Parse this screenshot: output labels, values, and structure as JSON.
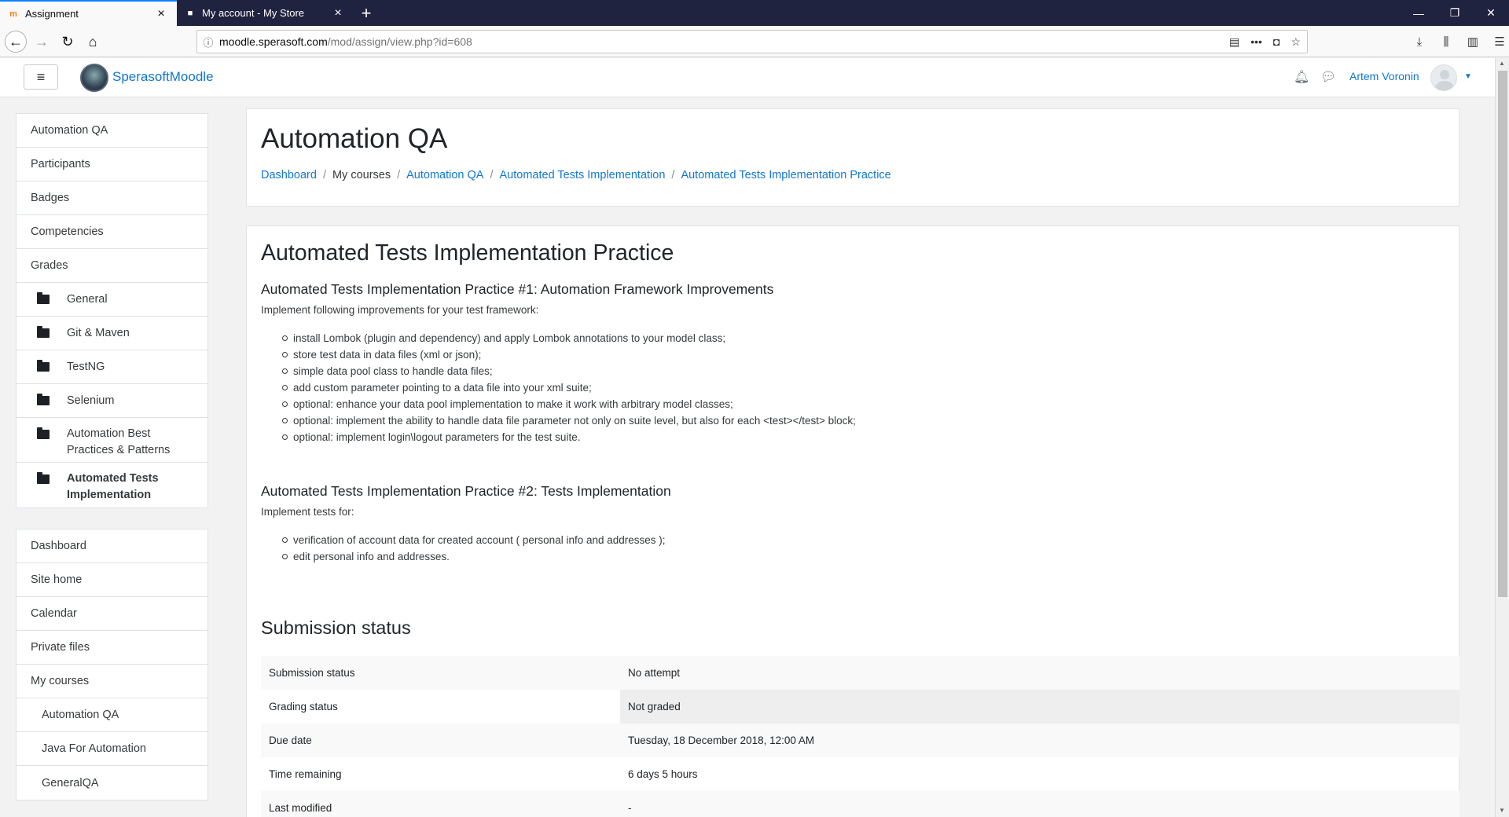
{
  "browser": {
    "tabs": [
      {
        "title": "Assignment",
        "active": true
      },
      {
        "title": "My account - My Store",
        "active": false
      }
    ],
    "url_host": "moodle.sperasoft.com",
    "url_path": "/mod/assign/view.php?id=608"
  },
  "header": {
    "brand": "SperasoftMoodle",
    "user_name": "Artem Voronin"
  },
  "sidebar": {
    "course_nav": [
      {
        "label": "Automation QA"
      },
      {
        "label": "Participants"
      },
      {
        "label": "Badges"
      },
      {
        "label": "Competencies"
      },
      {
        "label": "Grades"
      },
      {
        "label": "General"
      },
      {
        "label": "Git & Maven"
      },
      {
        "label": "TestNG"
      },
      {
        "label": "Selenium"
      },
      {
        "label": "Automation Best Practices & Patterns"
      },
      {
        "label": "Automated Tests Implementation"
      }
    ],
    "site_nav": [
      {
        "label": "Dashboard"
      },
      {
        "label": "Site home"
      },
      {
        "label": "Calendar"
      },
      {
        "label": "Private files"
      },
      {
        "label": "My courses"
      },
      {
        "label": "Automation QA"
      },
      {
        "label": "Java For Automation"
      },
      {
        "label": "GeneralQA"
      }
    ]
  },
  "page": {
    "course_title": "Automation QA",
    "breadcrumb": [
      "Dashboard",
      "My courses",
      "Automation QA",
      "Automated Tests Implementation",
      "Automated Tests Implementation Practice"
    ]
  },
  "assignment": {
    "title": "Automated Tests Implementation Practice",
    "section1_title": "Automated Tests Implementation Practice #1: Automation Framework Improvements",
    "section1_intro": "Implement following improvements for your test framework:",
    "section1_items": [
      "install Lombok (plugin and dependency) and apply Lombok annotations to your model class;",
      "store test data in data files (xml or json);",
      "simple data pool class to handle data files;",
      "add custom parameter pointing to a data file into your xml suite;",
      "optional: enhance your data pool implementation to make it work with arbitrary model classes;",
      "optional: implement the ability to handle data file parameter not only on suite level, but also for each <test></test> block;",
      "optional: implement login\\logout parameters for the test suite."
    ],
    "section2_title": "Automated Tests Implementation Practice #2: Tests Implementation",
    "section2_intro": "Implement tests for:",
    "section2_items": [
      "verification of account data for created account ( personal info and addresses );",
      "edit personal info and addresses."
    ]
  },
  "submission": {
    "title": "Submission status",
    "rows": [
      {
        "key": "Submission status",
        "value": "No attempt"
      },
      {
        "key": "Grading status",
        "value": "Not graded"
      },
      {
        "key": "Due date",
        "value": "Tuesday, 18 December 2018, 12:00 AM"
      },
      {
        "key": "Time remaining",
        "value": "6 days 5 hours"
      },
      {
        "key": "Last modified",
        "value": "-"
      }
    ]
  }
}
